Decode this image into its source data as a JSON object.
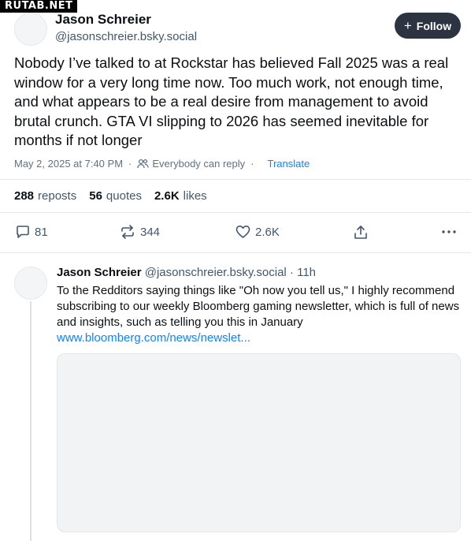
{
  "watermark": "RUTAB.NET",
  "post": {
    "author_name": "Jason Schreier",
    "author_handle": "@jasonschreier.bsky.social",
    "follow_label": "Follow",
    "text": "Nobody I’ve talked to at Rockstar has believed Fall 2025 was a real window for a very long time now. Too much work, not enough time, and what appears to be a real desire from management to avoid brutal crunch. GTA VI slipping to 2026 has seemed inevitable for months if not longer",
    "timestamp": "May 2, 2025 at 7:40 PM",
    "reply_permission": "Everybody can reply",
    "translate_label": "Translate"
  },
  "stats": {
    "reposts_count": "288",
    "reposts_label": "reposts",
    "quotes_count": "56",
    "quotes_label": "quotes",
    "likes_count": "2.6K",
    "likes_label": "likes"
  },
  "actions": {
    "reply_count": "81",
    "repost_count": "344",
    "like_count": "2.6K"
  },
  "reply": {
    "author_name": "Jason Schreier",
    "author_handle": "@jasonschreier.bsky.social · 11h",
    "text": "To the Redditors saying things like \"Oh now you tell us,\" I highly recommend subscribing to our weekly Bloomberg gaming newsletter, which is full of news and insights, such as telling you this in January",
    "link": "www.bloomberg.com/news/newslet..."
  },
  "icons": {
    "follow": "plus-icon",
    "reply_permission": "people-icon",
    "reply": "speech-bubble-icon",
    "repost": "repost-arrows-icon",
    "like": "heart-icon",
    "share": "share-icon",
    "more": "more-dots-icon"
  },
  "colors": {
    "follow_button": "#2b3440",
    "link": "#1083fe",
    "secondary_text": "#42576c"
  }
}
